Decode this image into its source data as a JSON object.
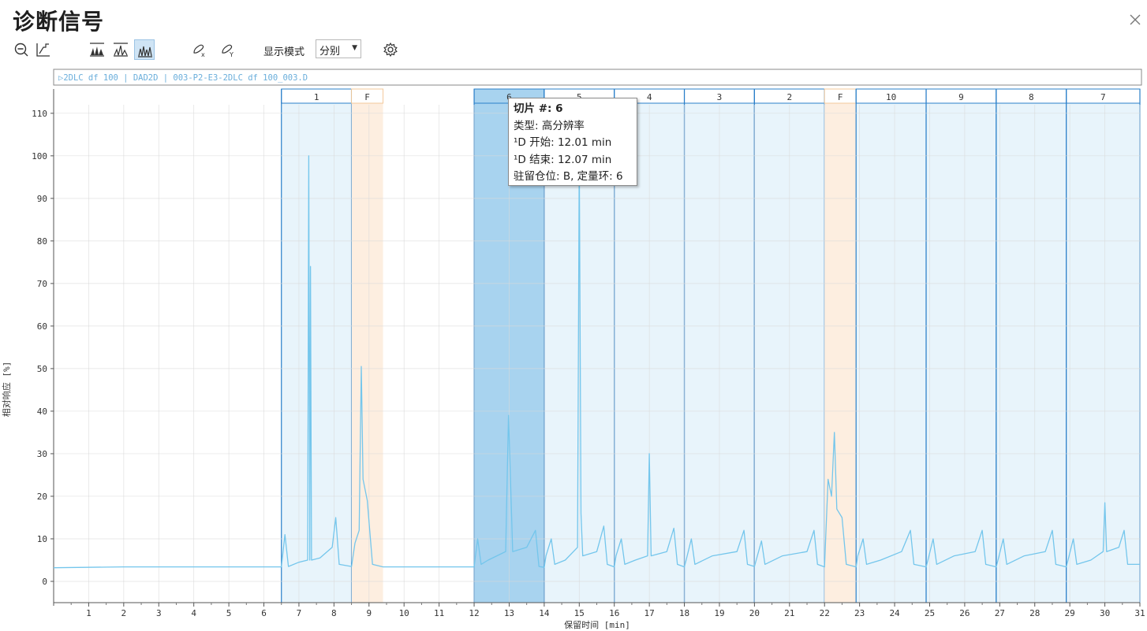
{
  "window": {
    "title": "诊断信号"
  },
  "toolbar": {
    "display_mode_label": "显示模式",
    "display_mode_value": "分别",
    "icons": [
      "zoom-out-icon",
      "reset-zoom-icon",
      "stacked-view-icon",
      "overlay-view-icon",
      "separate-view-icon",
      "link-x-icon",
      "link-y-icon",
      "settings-icon"
    ]
  },
  "chart_data": {
    "type": "line",
    "header_label": "▷2DLC df 100 | DAD2D | 003-P2-E3-2DLC df 100_003.D",
    "xlabel": "保留时间 [min]",
    "ylabel": "相对响应 [%]",
    "xlim": [
      0,
      31
    ],
    "ylim": [
      -5,
      112
    ],
    "x_ticks": [
      1,
      2,
      3,
      4,
      5,
      6,
      7,
      8,
      9,
      10,
      11,
      12,
      13,
      14,
      15,
      16,
      17,
      18,
      19,
      20,
      21,
      22,
      23,
      24,
      25,
      26,
      27,
      28,
      29,
      30,
      31
    ],
    "y_ticks": [
      0,
      10,
      20,
      30,
      40,
      50,
      60,
      70,
      80,
      90,
      100,
      110
    ],
    "grid": true,
    "colors": {
      "trace": "#74c6ec",
      "slice_fill": "#e8f4fb",
      "slice_border": "#2a7fc9",
      "selected_fill": "#a8d3ef",
      "fraction_fill": "#fdeee0",
      "fraction_border": "#f3c89a"
    },
    "slices": [
      {
        "label": "1",
        "kind": "slice",
        "start": 6.5,
        "end": 8.5
      },
      {
        "label": "F",
        "kind": "fraction",
        "start": 8.5,
        "end": 9.4
      },
      {
        "label": "6",
        "kind": "slice",
        "start": 12.0,
        "end": 14.0,
        "selected": true
      },
      {
        "label": "5",
        "kind": "slice",
        "start": 14.0,
        "end": 16.0
      },
      {
        "label": "4",
        "kind": "slice",
        "start": 16.0,
        "end": 18.0
      },
      {
        "label": "3",
        "kind": "slice",
        "start": 18.0,
        "end": 20.0
      },
      {
        "label": "2",
        "kind": "slice",
        "start": 20.0,
        "end": 22.0
      },
      {
        "label": "F",
        "kind": "fraction",
        "start": 22.0,
        "end": 22.9
      },
      {
        "label": "10",
        "kind": "slice",
        "start": 22.9,
        "end": 24.9
      },
      {
        "label": "9",
        "kind": "slice",
        "start": 24.9,
        "end": 26.9
      },
      {
        "label": "8",
        "kind": "slice",
        "start": 26.9,
        "end": 28.9
      },
      {
        "label": "7",
        "kind": "slice",
        "start": 28.9,
        "end": 31.0
      }
    ],
    "series": [
      {
        "name": "DAD2D",
        "points": [
          [
            0,
            3.2
          ],
          [
            2,
            3.4
          ],
          [
            4,
            3.4
          ],
          [
            6.5,
            3.4
          ],
          [
            6.6,
            11
          ],
          [
            6.7,
            3.5
          ],
          [
            7.0,
            4.5
          ],
          [
            7.25,
            5
          ],
          [
            7.28,
            100
          ],
          [
            7.31,
            5
          ],
          [
            7.33,
            74
          ],
          [
            7.36,
            5
          ],
          [
            7.6,
            5.5
          ],
          [
            7.95,
            8
          ],
          [
            8.05,
            15
          ],
          [
            8.15,
            4
          ],
          [
            8.5,
            3.5
          ],
          [
            8.6,
            9
          ],
          [
            8.72,
            12
          ],
          [
            8.78,
            50.5
          ],
          [
            8.83,
            24
          ],
          [
            8.95,
            19
          ],
          [
            9.1,
            4
          ],
          [
            9.4,
            3.4
          ],
          [
            12.0,
            3.4
          ],
          [
            12.1,
            10
          ],
          [
            12.2,
            4
          ],
          [
            12.4,
            5
          ],
          [
            12.9,
            7
          ],
          [
            12.98,
            39
          ],
          [
            13.02,
            29
          ],
          [
            13.1,
            7
          ],
          [
            13.5,
            8
          ],
          [
            13.75,
            12
          ],
          [
            13.85,
            3.5
          ],
          [
            14.0,
            3.3
          ],
          [
            14.05,
            6
          ],
          [
            14.2,
            10
          ],
          [
            14.3,
            4
          ],
          [
            14.6,
            5
          ],
          [
            14.95,
            8
          ],
          [
            15.0,
            100
          ],
          [
            15.05,
            16
          ],
          [
            15.1,
            6
          ],
          [
            15.5,
            7
          ],
          [
            15.7,
            13
          ],
          [
            15.8,
            4
          ],
          [
            16.0,
            3.4
          ],
          [
            16.05,
            6
          ],
          [
            16.2,
            10
          ],
          [
            16.3,
            4
          ],
          [
            16.6,
            5
          ],
          [
            16.95,
            6
          ],
          [
            17.0,
            30
          ],
          [
            17.05,
            6
          ],
          [
            17.5,
            7
          ],
          [
            17.7,
            12.5
          ],
          [
            17.8,
            4
          ],
          [
            18.0,
            3.4
          ],
          [
            18.05,
            5
          ],
          [
            18.2,
            10
          ],
          [
            18.3,
            4
          ],
          [
            18.8,
            6
          ],
          [
            19.5,
            7
          ],
          [
            19.7,
            12
          ],
          [
            19.8,
            4
          ],
          [
            20.0,
            3.5
          ],
          [
            20.05,
            5
          ],
          [
            20.2,
            9.5
          ],
          [
            20.3,
            4
          ],
          [
            20.8,
            6
          ],
          [
            21.5,
            7
          ],
          [
            21.7,
            12
          ],
          [
            21.8,
            4
          ],
          [
            22.0,
            3.4
          ],
          [
            22.1,
            24
          ],
          [
            22.2,
            20
          ],
          [
            22.28,
            35
          ],
          [
            22.35,
            17
          ],
          [
            22.5,
            15
          ],
          [
            22.62,
            4
          ],
          [
            22.9,
            3.4
          ],
          [
            22.95,
            6
          ],
          [
            23.1,
            10
          ],
          [
            23.2,
            4
          ],
          [
            23.6,
            5
          ],
          [
            24.2,
            7
          ],
          [
            24.45,
            12
          ],
          [
            24.55,
            4
          ],
          [
            24.9,
            3.4
          ],
          [
            24.95,
            5
          ],
          [
            25.1,
            10
          ],
          [
            25.2,
            4
          ],
          [
            25.7,
            6
          ],
          [
            26.3,
            7
          ],
          [
            26.5,
            12
          ],
          [
            26.6,
            4
          ],
          [
            26.9,
            3.4
          ],
          [
            26.95,
            5
          ],
          [
            27.1,
            10
          ],
          [
            27.2,
            4
          ],
          [
            27.7,
            6
          ],
          [
            28.3,
            7
          ],
          [
            28.5,
            12
          ],
          [
            28.6,
            4
          ],
          [
            28.9,
            3.4
          ],
          [
            28.95,
            5
          ],
          [
            29.1,
            10
          ],
          [
            29.2,
            4
          ],
          [
            29.6,
            5
          ],
          [
            29.95,
            7
          ],
          [
            30.0,
            18.5
          ],
          [
            30.05,
            7
          ],
          [
            30.4,
            8
          ],
          [
            30.55,
            12
          ],
          [
            30.65,
            4
          ],
          [
            31.0,
            4
          ]
        ]
      }
    ]
  },
  "tooltip": {
    "title": "切片 #: 6",
    "type_line": "类型: 高分辨率",
    "start_line": "¹D 开始: 12.01 min",
    "end_line": "¹D 结束: 12.07 min",
    "loop_line": "驻留仓位: B, 定量环: 6"
  }
}
